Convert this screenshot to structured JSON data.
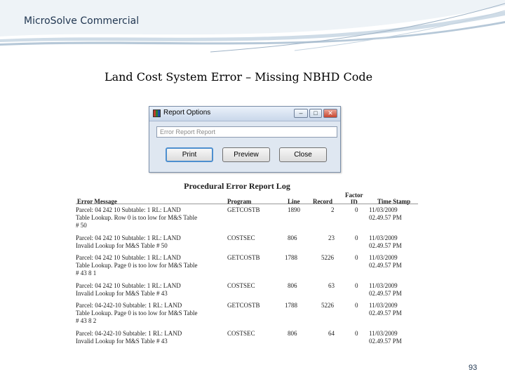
{
  "brand": "MicroSolve Commercial",
  "slide_title": "Land Cost System Error – Missing NBHD Code",
  "colors": {
    "brand_text": "#1f3550",
    "band_light": "#dde7ef",
    "band_dark": "#b6c8d8"
  },
  "dialog": {
    "title": "Report Options",
    "field_value": "Error Report Report",
    "buttons": {
      "print": "Print",
      "preview": "Preview",
      "close": "Close"
    },
    "window_controls": {
      "minimize": "–",
      "maximize": "□",
      "close": "✕"
    }
  },
  "report": {
    "title": "Procedural Error Report Log",
    "columns": {
      "message": "Error Message",
      "program": "Program",
      "line": "Line",
      "record": "Record",
      "factor_id": "Factor\nID",
      "timestamp": "Time Stamp"
    },
    "rows": [
      {
        "message": "Parcel: 04 242 10 Subtable: 1 RL: LAND\nTable Lookup. Row 0 is too low for M&S Table\n# 50",
        "program": "GETCOSTB",
        "line": "1890",
        "record": "2",
        "factor": "0",
        "timestamp": "11/03/2009\n02.49.57 PM"
      },
      {
        "message": "Parcel: 04 242 10 Subtable: 1 RL: LAND\nInvalid Lookup for M&S Table # 50",
        "program": "COSTSEC",
        "line": "806",
        "record": "23",
        "factor": "0",
        "timestamp": "11/03/2009\n02.49.57 PM"
      },
      {
        "message": "Parcel: 04 242 10 Subtable: 1 RL: LAND\nTable Lookup. Page 0 is too low for M&S Table\n# 43 8 1",
        "program": "GETCOSTB",
        "line": "1788",
        "record": "5226",
        "factor": "0",
        "timestamp": "11/03/2009\n02.49.57 PM"
      },
      {
        "message": "Parcel: 04 242 10 Subtable: 1 RL: LAND\nInvalid Lookup for M&S Table # 43",
        "program": "COSTSEC",
        "line": "806",
        "record": "63",
        "factor": "0",
        "timestamp": "11/03/2009\n02.49.57 PM"
      },
      {
        "message": "Parcel: 04-242-10 Subtable: 1 RL: LAND\nTable Lookup. Page 0 is too low for M&S Table\n# 43 8 2",
        "program": "GETCOSTB",
        "line": "1788",
        "record": "5226",
        "factor": "0",
        "timestamp": "11/03/2009\n02.49.57 PM"
      },
      {
        "message": "Parcel: 04-242-10 Subtable: 1 RL: LAND\nInvalid Lookup for M&S Table # 43",
        "program": "COSTSEC",
        "line": "806",
        "record": "64",
        "factor": "0",
        "timestamp": "11/03/2009\n02.49.57 PM"
      }
    ]
  },
  "slide_number": "93"
}
